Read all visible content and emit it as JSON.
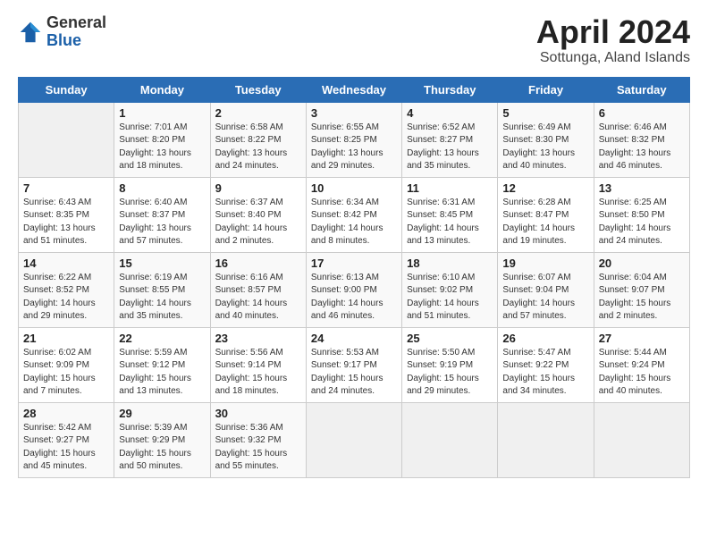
{
  "logo": {
    "general": "General",
    "blue": "Blue"
  },
  "title": "April 2024",
  "subtitle": "Sottunga, Aland Islands",
  "days_of_week": [
    "Sunday",
    "Monday",
    "Tuesday",
    "Wednesday",
    "Thursday",
    "Friday",
    "Saturday"
  ],
  "weeks": [
    [
      {
        "day": "",
        "info": ""
      },
      {
        "day": "1",
        "info": "Sunrise: 7:01 AM\nSunset: 8:20 PM\nDaylight: 13 hours\nand 18 minutes."
      },
      {
        "day": "2",
        "info": "Sunrise: 6:58 AM\nSunset: 8:22 PM\nDaylight: 13 hours\nand 24 minutes."
      },
      {
        "day": "3",
        "info": "Sunrise: 6:55 AM\nSunset: 8:25 PM\nDaylight: 13 hours\nand 29 minutes."
      },
      {
        "day": "4",
        "info": "Sunrise: 6:52 AM\nSunset: 8:27 PM\nDaylight: 13 hours\nand 35 minutes."
      },
      {
        "day": "5",
        "info": "Sunrise: 6:49 AM\nSunset: 8:30 PM\nDaylight: 13 hours\nand 40 minutes."
      },
      {
        "day": "6",
        "info": "Sunrise: 6:46 AM\nSunset: 8:32 PM\nDaylight: 13 hours\nand 46 minutes."
      }
    ],
    [
      {
        "day": "7",
        "info": "Sunrise: 6:43 AM\nSunset: 8:35 PM\nDaylight: 13 hours\nand 51 minutes."
      },
      {
        "day": "8",
        "info": "Sunrise: 6:40 AM\nSunset: 8:37 PM\nDaylight: 13 hours\nand 57 minutes."
      },
      {
        "day": "9",
        "info": "Sunrise: 6:37 AM\nSunset: 8:40 PM\nDaylight: 14 hours\nand 2 minutes."
      },
      {
        "day": "10",
        "info": "Sunrise: 6:34 AM\nSunset: 8:42 PM\nDaylight: 14 hours\nand 8 minutes."
      },
      {
        "day": "11",
        "info": "Sunrise: 6:31 AM\nSunset: 8:45 PM\nDaylight: 14 hours\nand 13 minutes."
      },
      {
        "day": "12",
        "info": "Sunrise: 6:28 AM\nSunset: 8:47 PM\nDaylight: 14 hours\nand 19 minutes."
      },
      {
        "day": "13",
        "info": "Sunrise: 6:25 AM\nSunset: 8:50 PM\nDaylight: 14 hours\nand 24 minutes."
      }
    ],
    [
      {
        "day": "14",
        "info": "Sunrise: 6:22 AM\nSunset: 8:52 PM\nDaylight: 14 hours\nand 29 minutes."
      },
      {
        "day": "15",
        "info": "Sunrise: 6:19 AM\nSunset: 8:55 PM\nDaylight: 14 hours\nand 35 minutes."
      },
      {
        "day": "16",
        "info": "Sunrise: 6:16 AM\nSunset: 8:57 PM\nDaylight: 14 hours\nand 40 minutes."
      },
      {
        "day": "17",
        "info": "Sunrise: 6:13 AM\nSunset: 9:00 PM\nDaylight: 14 hours\nand 46 minutes."
      },
      {
        "day": "18",
        "info": "Sunrise: 6:10 AM\nSunset: 9:02 PM\nDaylight: 14 hours\nand 51 minutes."
      },
      {
        "day": "19",
        "info": "Sunrise: 6:07 AM\nSunset: 9:04 PM\nDaylight: 14 hours\nand 57 minutes."
      },
      {
        "day": "20",
        "info": "Sunrise: 6:04 AM\nSunset: 9:07 PM\nDaylight: 15 hours\nand 2 minutes."
      }
    ],
    [
      {
        "day": "21",
        "info": "Sunrise: 6:02 AM\nSunset: 9:09 PM\nDaylight: 15 hours\nand 7 minutes."
      },
      {
        "day": "22",
        "info": "Sunrise: 5:59 AM\nSunset: 9:12 PM\nDaylight: 15 hours\nand 13 minutes."
      },
      {
        "day": "23",
        "info": "Sunrise: 5:56 AM\nSunset: 9:14 PM\nDaylight: 15 hours\nand 18 minutes."
      },
      {
        "day": "24",
        "info": "Sunrise: 5:53 AM\nSunset: 9:17 PM\nDaylight: 15 hours\nand 24 minutes."
      },
      {
        "day": "25",
        "info": "Sunrise: 5:50 AM\nSunset: 9:19 PM\nDaylight: 15 hours\nand 29 minutes."
      },
      {
        "day": "26",
        "info": "Sunrise: 5:47 AM\nSunset: 9:22 PM\nDaylight: 15 hours\nand 34 minutes."
      },
      {
        "day": "27",
        "info": "Sunrise: 5:44 AM\nSunset: 9:24 PM\nDaylight: 15 hours\nand 40 minutes."
      }
    ],
    [
      {
        "day": "28",
        "info": "Sunrise: 5:42 AM\nSunset: 9:27 PM\nDaylight: 15 hours\nand 45 minutes."
      },
      {
        "day": "29",
        "info": "Sunrise: 5:39 AM\nSunset: 9:29 PM\nDaylight: 15 hours\nand 50 minutes."
      },
      {
        "day": "30",
        "info": "Sunrise: 5:36 AM\nSunset: 9:32 PM\nDaylight: 15 hours\nand 55 minutes."
      },
      {
        "day": "",
        "info": ""
      },
      {
        "day": "",
        "info": ""
      },
      {
        "day": "",
        "info": ""
      },
      {
        "day": "",
        "info": ""
      }
    ]
  ]
}
